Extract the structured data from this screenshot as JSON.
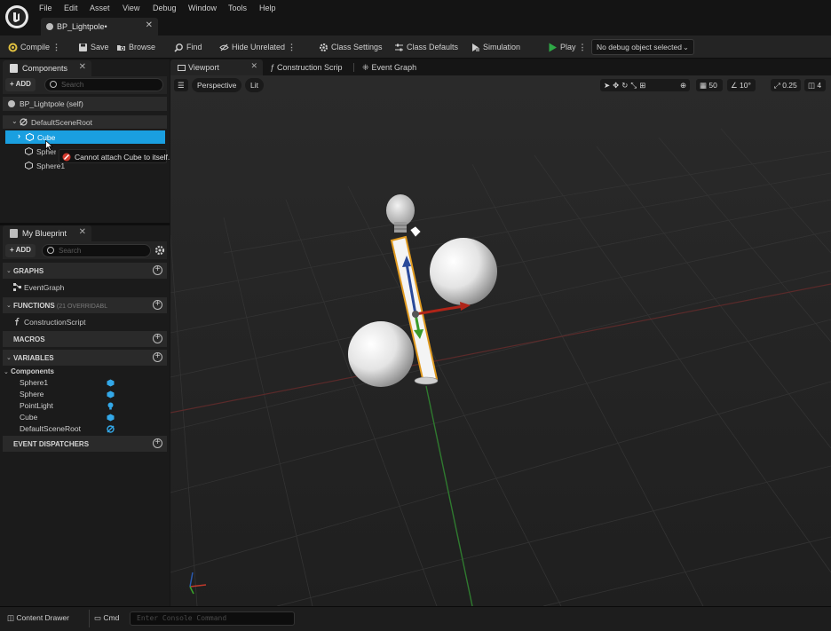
{
  "menubar": {
    "items": [
      "File",
      "Edit",
      "Asset",
      "View",
      "Debug",
      "Window",
      "Tools",
      "Help"
    ],
    "document_tab": "BP_Lightpole•"
  },
  "toolbar": {
    "compile": "Compile",
    "save": "Save",
    "browse": "Browse",
    "find": "Find",
    "hide_unrelated": "Hide Unrelated",
    "class_settings": "Class Settings",
    "class_defaults": "Class Defaults",
    "simulation": "Simulation",
    "play": "Play",
    "debug_select": "No debug object selected"
  },
  "components_panel": {
    "tab": "Components",
    "add": "ADD",
    "search_placeholder": "Search",
    "self_item": "BP_Lightpole (self)",
    "tree": [
      "DefaultSceneRoot",
      "Cube",
      "Sphere",
      "Sphere1"
    ],
    "tooltip": "Cannot attach Cube to itself."
  },
  "blueprint_panel": {
    "tab": "My Blueprint",
    "add": "ADD",
    "search_placeholder": "Search",
    "graphs_header": "GRAPHS",
    "graphs": [
      "EventGraph"
    ],
    "functions_header": "FUNCTIONS",
    "functions_note": "(21 OVERRIDABL",
    "functions": [
      "ConstructionScript"
    ],
    "macros_header": "MACROS",
    "variables_header": "VARIABLES",
    "variables_group": "Components",
    "variables": [
      "Sphere1",
      "Sphere",
      "PointLight",
      "Cube",
      "DefaultSceneRoot"
    ],
    "dispatchers_header": "EVENT DISPATCHERS"
  },
  "viewport": {
    "tabs": [
      "Viewport",
      "Construction Scrip",
      "Event Graph"
    ],
    "perspective": "Perspective",
    "lit": "Lit",
    "grid_snap": "50",
    "rotation_snap": "10°",
    "scale_snap": "0.25",
    "camera_speed": "4"
  },
  "bottombar": {
    "content_drawer": "Content Drawer",
    "cmd": "Cmd",
    "console_placeholder": "Enter Console Command"
  },
  "colors": {
    "selection": "#1a9fe0",
    "play_green": "#2ea846",
    "error_red": "#d23a2e",
    "component_icon": "#33a8e8"
  }
}
